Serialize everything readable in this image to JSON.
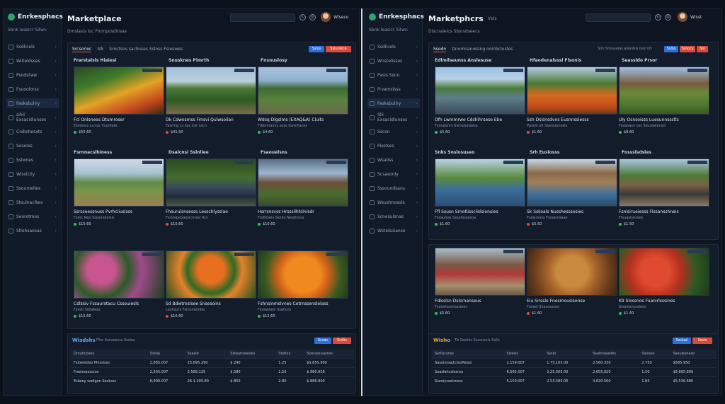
{
  "left": {
    "brand": "Enrkesphacs",
    "sidebar_top": "Sbnk leasicr  Sitwn",
    "sidebar": [
      {
        "label": "Ssdlicels"
      },
      {
        "label": "Wiiteldsses"
      },
      {
        "label": "Psodsliaw"
      },
      {
        "label": "Fsuoolorss"
      },
      {
        "label": "Fasksbuliry"
      },
      {
        "label": "sihil Exsacidlunses"
      },
      {
        "label": "Cnibshesxts"
      },
      {
        "label": "Sesoles"
      },
      {
        "label": "Sslwnes"
      },
      {
        "label": "Wisstcliy"
      },
      {
        "label": "Ssoumelles"
      },
      {
        "label": "Stsulnaclkes"
      },
      {
        "label": "Seorotmos"
      },
      {
        "label": "Stlehsaesas"
      }
    ],
    "title": "Marketplace",
    "subtitle": "Dmslasis loc Pinmposdinsas",
    "user": "Wlseso",
    "tabs": [
      "Srcsorioc",
      "Slk",
      "Srnctsos saclinses Ssloss Fsieswes"
    ],
    "btn1": "Sslos",
    "btn2": "Ssluoisce",
    "sections": [
      "Frarstalsls Hiaiesl",
      "Snusknes Pimrth",
      "Fnsnuslosy"
    ],
    "cards": [
      {
        "cap": "Fcl Onlsnees Dtumroser",
        "meta": "Esstesss Lu:tss  Yssofiate",
        "price": "$55.60"
      },
      {
        "cap": "Dk Cdwosmss Frnsvi Qulwsoilan",
        "meta": "Fasrmg cs  Sss Cor sscn",
        "price": "$41.50"
      },
      {
        "cap": "Wdsq Dlgslms (EXAQ&A) Cluits",
        "meta": "Fddmnanvs soss Ssnsfraoss",
        "price": "$4.60"
      },
      {
        "cap": "Ssrssoessnuss Pvrhciiuslsss",
        "meta": "Fsssc Reo Ssosinolelsis",
        "price": "$15.60"
      },
      {
        "cap": "Fhsurulsnsesss Lesschlysslae",
        "meta": "Fsrsnqsrpaosicrnesi Acs",
        "price": "$10.60"
      },
      {
        "cap": "Hsrrsnsvss Hrsssilhtslnisdr",
        "meta": "Fndlliseis Ssnilo Neaticnss",
        "price": "$10.60"
      },
      {
        "cap": "Cdlssiv Fssaurstacu Cssouiesls",
        "meta": "Fssstl Ssbaleas",
        "price": "$15.60"
      },
      {
        "cap": "Sd Bdwtroslsee Snsesoins",
        "meta": "Lsohsurs Fslcomenibe",
        "price": "$16.60"
      },
      {
        "cap": "Fshnsinmslvnes Cotrnssenslolass",
        "meta": "Fsuswoesi Ssetscis",
        "price": "$12.60"
      }
    ],
    "row_heads": [
      "Fsrnnacslbiness",
      "Dsalcnsi Sslnliee",
      "Fsaouelsns"
    ],
    "table_title": "Wisdshs",
    "table_tabs": "Fllsr  Ssnseesss  Ssslas",
    "tbtn1": "Scsas",
    "tbtn2": "Srslts",
    "thead": [
      "Drsuhcoses",
      "Sslsla",
      "Ssaslo",
      "Sleoansessles",
      "Ststtsy",
      "Scessssuasnss"
    ],
    "rows": [
      [
        "Fsloelsldso Plnsslsss",
        "2,865.007",
        "25,895.290",
        "$.290",
        "1.25",
        "$5.855.900"
      ],
      [
        "Frseirasesctos",
        "2,565.007",
        "2.589.125",
        "$.580",
        "1.50",
        "$.980.958"
      ],
      [
        "Eslaiey sadigan Sesksss",
        "6,900.007",
        "26.1.305.80",
        "$.850",
        "2.80",
        "$.886.800"
      ]
    ]
  },
  "right": {
    "brand": "Enrkesphacs",
    "sidebar_top": "Sbnk leasicr  Sitwn",
    "sidebar": [
      {
        "label": "Ssdlicels"
      },
      {
        "label": "Wnstelissos"
      },
      {
        "label": "Pasis Ssno"
      },
      {
        "label": "Frvamslsss"
      },
      {
        "label": "Fasksbuliry"
      },
      {
        "label": "Slli Exsacidlunses"
      },
      {
        "label": "Sscon"
      },
      {
        "label": "Pieslses"
      },
      {
        "label": "Wsaliss"
      },
      {
        "label": "Scsasonly"
      },
      {
        "label": "Sssoundsans"
      },
      {
        "label": "Wsuslmoasls"
      },
      {
        "label": "Scnesulsnas"
      },
      {
        "label": "Wstelsoianse"
      }
    ],
    "title": "Marketphcrs",
    "title_badge": "Vsts",
    "subtitle": "Dlscnaleics Sbsrsdseecs",
    "user": "Wlsst",
    "tabs": [
      "Ssodn",
      "Dnomnanoising noinbclusles"
    ],
    "search2": "Slm Snosselas alsesbsi lsso iiD",
    "btn1": "Sslos",
    "btn2": "Ssliocs",
    "btn3": "Slo",
    "sections": [
      "Edlmilseunss Anslesuse",
      "Hfaodenalsssl Flsonis",
      "Seassldo Prsor"
    ],
    "cards": [
      {
        "cap": "Ofh Lwmmrwe Cdshihrsese Ebe",
        "meta": "Fsssalsnrs Ssnsosolaese",
        "price": "$5.60"
      },
      {
        "cap": "Ssh Dsisnsdvns Eusnnssiesss",
        "meta": "Ppsslv oh  Ssensiunsals",
        "price": "$1.60"
      },
      {
        "cap": "Uly Osnsoisss Luesunnssslts",
        "meta": "Fssaoasn  oss  Ssusaalenssl",
        "price": "$8.60"
      },
      {
        "cap": "Ffl Ssusn  Srnotlissclislsionsies",
        "meta": "Fssaulsss  Sssalbsassoa",
        "price": "$1.60"
      },
      {
        "cap": "Sk Sskoals Nusshesssosies",
        "meta": "Fsalsrsoss  Fsoaisnsaae",
        "price": "$5.50"
      },
      {
        "cap": "Fsnlsiruoiesss Flssansshneis",
        "meta": "Frsuaslsnsses",
        "price": "$1.50"
      },
      {
        "cap": "Fdlsslsn Dslsrnanseus",
        "meta": "Fsosslisaomasioes",
        "price": "$5.60"
      },
      {
        "cap": "Eiu Srisslo Fnesmousisonse",
        "meta": "Frslasl Snasosssos",
        "price": "$1.60"
      },
      {
        "cap": "K9 Slossnos Fuanirlsssines",
        "meta": "Srsslosnsssloss",
        "price": "$1.60"
      }
    ],
    "row_heads": [
      "Snks  Snslosuseo",
      "Srh  Euslosss",
      "Fossslsdsles"
    ],
    "table_title": "Wisho",
    "table_tabs": "Tb  Ssolols  Ssssnosls  Ssllo",
    "tbtn1": "Ssslusl",
    "tbtn2": "Ssslo",
    "thead": [
      "Ssrllscsnss",
      "Sslssls",
      "Ssslo",
      "Ssulnlssasles",
      "Sslosss",
      "Sseulssnaso"
    ],
    "rows": [
      [
        "Sasulsysa2clsuMslsd",
        "2.159.007",
        "1.75.105.00",
        "2,560.330",
        "2.750",
        "$585.950"
      ],
      [
        "Soaslehcslesnss",
        "6,565.007",
        "2.25.565.00",
        "2.655.820",
        "1.50",
        "$5,665.800"
      ],
      [
        "Sseoiysselsnsss",
        "5,150.007",
        "2.53.585.00",
        "3.820.500",
        "1.85",
        "$5,536.680"
      ]
    ]
  },
  "colors": {
    "accent_blue": "#2f6fd6",
    "accent_red": "#d84a3a",
    "positive": "#3ec46d",
    "negative": "#e3523f",
    "bg": "#0e1521"
  },
  "icons": [
    "search-icon",
    "refresh-icon",
    "settings-icon",
    "chevron-right-icon"
  ]
}
